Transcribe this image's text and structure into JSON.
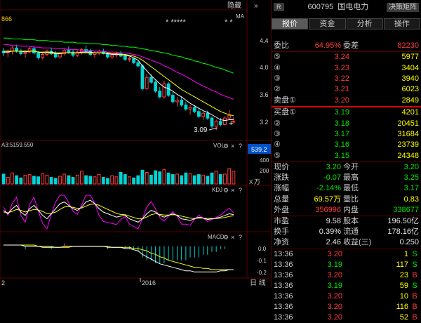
{
  "chart": {
    "top_left_value": "866",
    "hide_label": "隐藏",
    "hide_arrow": "»",
    "ma_label": "MA",
    "stars_left": "* *****",
    "stars_right": "* *",
    "price_ticks": [
      "4.4",
      "4.0",
      "3.6",
      "3.2"
    ],
    "low_annotation": "3.09",
    "vol_label": "VOL",
    "ma_vol_text": "A3:5159.550",
    "vol_box_value": "539.2",
    "vol_ticks": [
      "400",
      "200"
    ],
    "vol_unit": "万",
    "vol_unit_prefix": "X",
    "kdj_label": "KDJ",
    "macd_label": "MACD",
    "macd_ticks": [
      "0.0",
      "-0.1",
      "-0.2"
    ],
    "x_label_left": "2",
    "x_label_year": "2016",
    "period_label": "日 线"
  },
  "panel": {
    "r_badge": "R",
    "stock_code": "600795",
    "stock_name": "国电电力",
    "decision_button": "决策矩阵",
    "tabs": [
      "报价",
      "资金",
      "分析",
      "操作"
    ],
    "weibi": {
      "label": "委比",
      "pct": "64.95%",
      "label2": "委差",
      "value": "82230"
    },
    "sell": [
      {
        "label": "⑤",
        "price": "3.24",
        "vol": "5977"
      },
      {
        "label": "④",
        "price": "3.23",
        "vol": "3404"
      },
      {
        "label": "③",
        "price": "3.22",
        "vol": "3940"
      },
      {
        "label": "②",
        "price": "3.21",
        "vol": "6023"
      },
      {
        "label": "卖盘①",
        "price": "3.20",
        "vol": "2849"
      }
    ],
    "buy": [
      {
        "label": "买盘①",
        "price": "3.19",
        "vol": "4201"
      },
      {
        "label": "②",
        "price": "3.18",
        "vol": "20451"
      },
      {
        "label": "③",
        "price": "3.17",
        "vol": "31684"
      },
      {
        "label": "④",
        "price": "3.16",
        "vol": "23739"
      },
      {
        "label": "⑤",
        "price": "3.15",
        "vol": "24348"
      }
    ],
    "quote": [
      {
        "l1": "现价",
        "v1": "3.20",
        "l2": "今开",
        "v2": "3.20",
        "c1": "green",
        "c2": "green"
      },
      {
        "l1": "涨跌",
        "v1": "-0.07",
        "l2": "最高",
        "v2": "3.25",
        "c1": "green",
        "c2": "green"
      },
      {
        "l1": "涨幅",
        "v1": "-2.14%",
        "l2": "最低",
        "v2": "3.17",
        "c1": "green",
        "c2": "green"
      },
      {
        "l1": "总量",
        "v1": "69.57万",
        "l2": "量比",
        "v2": "0.83",
        "c1": "yellow",
        "c2": "yellow"
      },
      {
        "l1": "外盘",
        "v1": "356996",
        "l2": "内盘",
        "v2": "338677",
        "c1": "red",
        "c2": "green"
      }
    ],
    "fundamentals": [
      {
        "l1": "市盈",
        "v1": "9.58",
        "l2": "股本",
        "v2": "196.50亿"
      },
      {
        "l1": "换手",
        "v1": "0.39%",
        "l2": "流通",
        "v2": "178.16亿"
      },
      {
        "l1": "净资",
        "v1": "2.46",
        "l2": "收益(三)",
        "v2": "0.250"
      }
    ],
    "ticks": [
      {
        "time": "13:36",
        "price": "3.20",
        "vol": "1",
        "side": "S",
        "pc": "red",
        "sc": "green"
      },
      {
        "time": "13:36",
        "price": "3.19",
        "vol": "117",
        "side": "S",
        "pc": "green",
        "sc": "green"
      },
      {
        "time": "13:36",
        "price": "3.20",
        "vol": "23",
        "side": "B",
        "pc": "red",
        "sc": "red"
      },
      {
        "time": "13:36",
        "price": "3.19",
        "vol": "59",
        "side": "S",
        "pc": "green",
        "sc": "green"
      },
      {
        "time": "13:36",
        "price": "3.20",
        "vol": "10",
        "side": "B",
        "pc": "red",
        "sc": "red"
      },
      {
        "time": "13:36",
        "price": "3.20",
        "vol": "116",
        "side": "B",
        "pc": "red",
        "sc": "red"
      },
      {
        "time": "13:36",
        "price": "3.20",
        "vol": "52",
        "side": "B",
        "pc": "red",
        "sc": "red"
      }
    ]
  },
  "chart_data": {
    "type": "candlestick",
    "price_range": [
      3.0,
      4.55
    ],
    "candles": [
      [
        4.06,
        4.1,
        4.0,
        4.04
      ],
      [
        4.04,
        4.08,
        3.99,
        4.06
      ],
      [
        4.06,
        4.12,
        4.02,
        4.1
      ],
      [
        4.1,
        4.14,
        4.04,
        4.06
      ],
      [
        4.06,
        4.09,
        4.01,
        4.03
      ],
      [
        4.03,
        4.07,
        3.98,
        4.05
      ],
      [
        4.05,
        4.11,
        4.03,
        4.09
      ],
      [
        4.09,
        4.12,
        4.02,
        4.04
      ],
      [
        4.04,
        4.06,
        3.96,
        3.98
      ],
      [
        3.98,
        4.04,
        3.96,
        4.02
      ],
      [
        4.02,
        4.08,
        4.0,
        4.06
      ],
      [
        4.06,
        4.1,
        4.01,
        4.03
      ],
      [
        4.03,
        4.06,
        3.97,
        3.99
      ],
      [
        3.99,
        4.05,
        3.97,
        4.03
      ],
      [
        4.03,
        4.09,
        4.01,
        4.07
      ],
      [
        4.07,
        4.12,
        4.03,
        4.05
      ],
      [
        4.05,
        4.08,
        3.99,
        4.01
      ],
      [
        4.01,
        4.07,
        3.99,
        4.05
      ],
      [
        4.05,
        4.1,
        4.02,
        4.08
      ],
      [
        4.08,
        4.13,
        4.04,
        4.06
      ],
      [
        4.06,
        4.09,
        4.0,
        4.02
      ],
      [
        4.02,
        4.06,
        3.98,
        4.04
      ],
      [
        4.04,
        4.08,
        4.01,
        4.06
      ],
      [
        4.06,
        4.09,
        4.02,
        4.03
      ],
      [
        4.03,
        4.05,
        3.97,
        3.99
      ],
      [
        3.99,
        4.03,
        3.96,
        4.01
      ],
      [
        4.01,
        4.05,
        3.98,
        4.03
      ],
      [
        4.03,
        4.06,
        3.99,
        4.0
      ],
      [
        4.0,
        4.02,
        3.94,
        3.96
      ],
      [
        3.96,
        3.99,
        3.93,
        3.97
      ],
      [
        3.97,
        3.98,
        3.9,
        3.92
      ],
      [
        3.92,
        3.94,
        3.86,
        3.88
      ],
      [
        3.88,
        3.9,
        3.58,
        3.6
      ],
      [
        3.6,
        3.78,
        3.58,
        3.74
      ],
      [
        3.74,
        3.78,
        3.66,
        3.68
      ],
      [
        3.68,
        3.7,
        3.55,
        3.57
      ],
      [
        3.57,
        3.62,
        3.48,
        3.5
      ],
      [
        3.5,
        3.7,
        3.48,
        3.66
      ],
      [
        3.66,
        3.68,
        3.5,
        3.52
      ],
      [
        3.52,
        3.56,
        3.42,
        3.44
      ],
      [
        3.44,
        3.5,
        3.38,
        3.46
      ],
      [
        3.46,
        3.5,
        3.38,
        3.4
      ],
      [
        3.4,
        3.44,
        3.33,
        3.35
      ],
      [
        3.35,
        3.4,
        3.28,
        3.37
      ],
      [
        3.37,
        3.4,
        3.3,
        3.32
      ],
      [
        3.32,
        3.36,
        3.24,
        3.26
      ],
      [
        3.26,
        3.32,
        3.22,
        3.3
      ],
      [
        3.3,
        3.33,
        3.22,
        3.24
      ],
      [
        3.24,
        3.26,
        3.12,
        3.14
      ],
      [
        3.14,
        3.22,
        3.09,
        3.2
      ],
      [
        3.2,
        3.24,
        3.14,
        3.16
      ],
      [
        3.16,
        3.26,
        3.15,
        3.24
      ],
      [
        3.24,
        3.34,
        3.22,
        3.27
      ],
      [
        3.2,
        3.25,
        3.17,
        3.2
      ]
    ],
    "ma_series": [
      {
        "color": "#ffffff",
        "values": [
          4.05,
          4.05,
          4.06,
          4.06,
          4.06,
          4.05,
          4.06,
          4.06,
          4.05,
          4.04,
          4.04,
          4.04,
          4.03,
          4.03,
          4.04,
          4.04,
          4.04,
          4.04,
          4.05,
          4.05,
          4.05,
          4.04,
          4.04,
          4.04,
          4.03,
          4.02,
          4.02,
          4.02,
          4.01,
          4.0,
          3.98,
          3.95,
          3.88,
          3.82,
          3.76,
          3.71,
          3.66,
          3.62,
          3.6,
          3.57,
          3.53,
          3.5,
          3.46,
          3.42,
          3.39,
          3.36,
          3.33,
          3.31,
          3.28,
          3.25,
          3.22,
          3.21,
          3.22,
          3.22
        ]
      },
      {
        "color": "#ffff00",
        "values": [
          4.06,
          4.06,
          4.06,
          4.06,
          4.06,
          4.06,
          4.06,
          4.06,
          4.05,
          4.05,
          4.05,
          4.05,
          4.04,
          4.04,
          4.04,
          4.04,
          4.04,
          4.04,
          4.04,
          4.04,
          4.04,
          4.04,
          4.04,
          4.04,
          4.04,
          4.03,
          4.03,
          4.02,
          4.02,
          4.01,
          4.0,
          3.98,
          3.95,
          3.91,
          3.87,
          3.83,
          3.79,
          3.75,
          3.71,
          3.67,
          3.63,
          3.59,
          3.56,
          3.53,
          3.5,
          3.47,
          3.44,
          3.41,
          3.38,
          3.35,
          3.32,
          3.3,
          3.28,
          3.27
        ]
      },
      {
        "color": "#ff00ff",
        "values": [
          4.14,
          4.14,
          4.13,
          4.13,
          4.12,
          4.12,
          4.12,
          4.11,
          4.11,
          4.1,
          4.1,
          4.1,
          4.09,
          4.09,
          4.09,
          4.08,
          4.08,
          4.08,
          4.07,
          4.07,
          4.07,
          4.06,
          4.06,
          4.06,
          4.05,
          4.05,
          4.05,
          4.04,
          4.04,
          4.03,
          4.02,
          4.01,
          3.99,
          3.97,
          3.95,
          3.93,
          3.91,
          3.88,
          3.86,
          3.83,
          3.8,
          3.78,
          3.75,
          3.72,
          3.69,
          3.66,
          3.63,
          3.61,
          3.58,
          3.56,
          3.53,
          3.51,
          3.49,
          3.47
        ]
      },
      {
        "color": "#00ff00",
        "values": [
          4.22,
          4.22,
          4.21,
          4.21,
          4.21,
          4.2,
          4.2,
          4.2,
          4.19,
          4.19,
          4.19,
          4.18,
          4.18,
          4.18,
          4.17,
          4.17,
          4.17,
          4.16,
          4.16,
          4.16,
          4.15,
          4.15,
          4.15,
          4.14,
          4.14,
          4.13,
          4.13,
          4.12,
          4.12,
          4.11,
          4.11,
          4.1,
          4.09,
          4.08,
          4.07,
          4.06,
          4.05,
          4.04,
          4.03,
          4.01,
          4.0,
          3.99,
          3.97,
          3.96,
          3.94,
          3.93,
          3.91,
          3.9,
          3.88,
          3.86,
          3.85,
          3.83,
          3.81,
          3.79
        ]
      }
    ],
    "volume_range": [
      0,
      560
    ],
    "volumes": [
      180,
      120,
      200,
      150,
      110,
      160,
      170,
      140,
      130,
      190,
      160,
      120,
      100,
      140,
      180,
      150,
      120,
      160,
      230,
      150,
      140,
      130,
      170,
      120,
      100,
      150,
      130,
      210,
      170,
      130,
      110,
      150,
      250,
      210,
      160,
      240,
      220,
      260,
      200,
      170,
      180,
      150,
      200,
      190,
      150,
      170,
      160,
      140,
      200,
      230,
      170,
      180,
      280,
      230
    ],
    "kdj": {
      "range": [
        0,
        100
      ],
      "k": [
        55,
        45,
        60,
        70,
        50,
        40,
        60,
        70,
        55,
        40,
        30,
        45,
        60,
        75,
        80,
        70,
        60,
        55,
        65,
        80,
        85,
        75,
        60,
        50,
        45,
        40,
        35,
        38,
        40,
        30,
        25,
        20,
        30,
        45,
        55,
        50,
        40,
        35,
        40,
        45,
        40,
        30,
        28,
        25,
        30,
        35,
        32,
        28,
        30,
        32,
        35,
        40,
        45,
        42
      ],
      "d": [
        50,
        48,
        52,
        58,
        55,
        50,
        54,
        58,
        56,
        52,
        45,
        46,
        50,
        58,
        65,
        66,
        64,
        61,
        62,
        68,
        73,
        74,
        70,
        64,
        58,
        52,
        46,
        43,
        42,
        38,
        34,
        30,
        30,
        35,
        42,
        45,
        43,
        41,
        41,
        42,
        41,
        38,
        35,
        32,
        31,
        32,
        32,
        31,
        31,
        31,
        32,
        34,
        37,
        39
      ],
      "j": [
        65,
        40,
        76,
        94,
        40,
        20,
        72,
        94,
        53,
        16,
        0,
        43,
        80,
        100,
        100,
        78,
        52,
        43,
        71,
        100,
        100,
        77,
        40,
        22,
        19,
        16,
        13,
        28,
        36,
        14,
        7,
        0,
        30,
        65,
        81,
        60,
        34,
        23,
        38,
        51,
        38,
        14,
        14,
        11,
        28,
        41,
        32,
        22,
        28,
        34,
        41,
        52,
        61,
        48
      ]
    },
    "macd": {
      "range": [
        -0.26,
        0.04
      ],
      "dif": [
        0.01,
        0.01,
        0.01,
        0.01,
        0.01,
        0.0,
        0.0,
        0.0,
        0.0,
        -0.01,
        -0.01,
        -0.01,
        -0.01,
        -0.01,
        0.0,
        0.0,
        0.0,
        0.0,
        0.0,
        0.0,
        0.0,
        0.0,
        0.0,
        0.0,
        -0.01,
        -0.01,
        -0.01,
        -0.01,
        -0.02,
        -0.02,
        -0.03,
        -0.04,
        -0.07,
        -0.09,
        -0.11,
        -0.13,
        -0.15,
        -0.16,
        -0.17,
        -0.18,
        -0.19,
        -0.2,
        -0.21,
        -0.21,
        -0.22,
        -0.22,
        -0.22,
        -0.22,
        -0.22,
        -0.22,
        -0.21,
        -0.21,
        -0.2,
        -0.2
      ],
      "dea": [
        0.01,
        0.01,
        0.01,
        0.01,
        0.01,
        0.01,
        0.01,
        0.01,
        0.0,
        0.0,
        0.0,
        0.0,
        -0.01,
        -0.01,
        -0.01,
        -0.01,
        0.0,
        0.0,
        0.0,
        0.0,
        0.0,
        0.0,
        0.0,
        0.0,
        0.0,
        -0.01,
        -0.01,
        -0.01,
        -0.01,
        -0.01,
        -0.02,
        -0.02,
        -0.03,
        -0.04,
        -0.06,
        -0.07,
        -0.09,
        -0.1,
        -0.12,
        -0.13,
        -0.14,
        -0.15,
        -0.16,
        -0.17,
        -0.18,
        -0.18,
        -0.19,
        -0.19,
        -0.2,
        -0.2,
        -0.2,
        -0.2,
        -0.2,
        -0.2
      ],
      "hist": [
        0.0,
        0.0,
        0.0,
        0.0,
        0.0,
        -0.01,
        0.0,
        0.0,
        0.0,
        0.0,
        0.0,
        -0.01,
        0.0,
        0.0,
        0.01,
        0.0,
        0.0,
        0.0,
        0.0,
        0.0,
        0.0,
        0.0,
        0.0,
        0.0,
        -0.01,
        0.0,
        0.0,
        0.0,
        -0.01,
        -0.01,
        -0.01,
        -0.02,
        -0.04,
        -0.05,
        -0.05,
        -0.06,
        -0.06,
        -0.06,
        -0.05,
        -0.05,
        -0.05,
        -0.05,
        -0.05,
        -0.04,
        -0.04,
        -0.04,
        -0.03,
        -0.03,
        -0.02,
        -0.02,
        -0.01,
        -0.01,
        0.0,
        0.0
      ]
    }
  }
}
